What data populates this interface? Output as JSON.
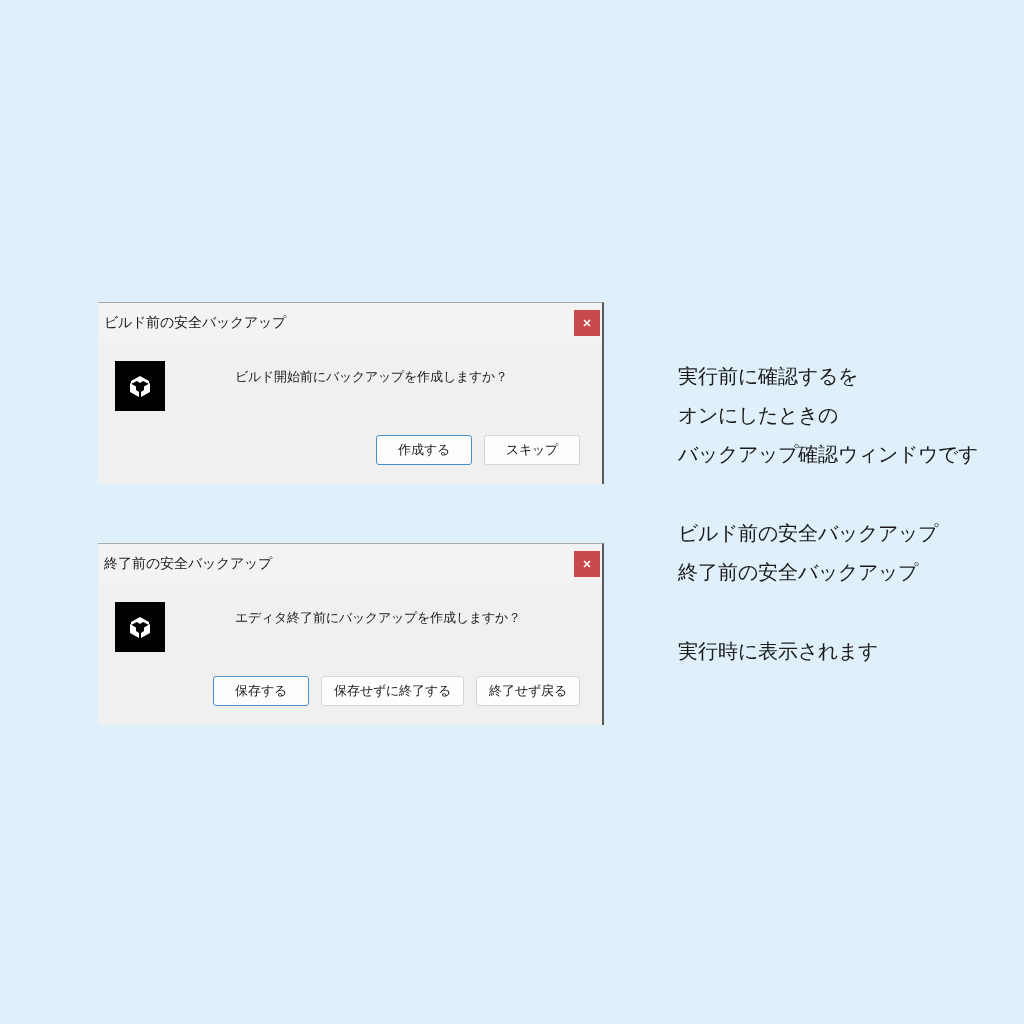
{
  "dialogs": [
    {
      "title": "ビルド前の安全バックアップ",
      "message": "ビルド開始前にバックアップを作成しますか？",
      "buttons": [
        {
          "label": "作成する",
          "default": true
        },
        {
          "label": "スキップ",
          "default": false
        }
      ]
    },
    {
      "title": "終了前の安全バックアップ",
      "message": "エディタ終了前にバックアップを作成しますか？",
      "buttons": [
        {
          "label": "保存する",
          "default": true
        },
        {
          "label": "保存せずに終了する",
          "default": false
        },
        {
          "label": "終了せず戻る",
          "default": false
        }
      ]
    }
  ],
  "notes": [
    {
      "lines": [
        "実行前に確認するを",
        "オンにしたときの",
        "バックアップ確認ウィンドウです"
      ]
    },
    {
      "lines": [
        "ビルド前の安全バックアップ",
        "終了前の安全バックアップ"
      ]
    },
    {
      "lines": [
        "実行時に表示されます"
      ]
    }
  ]
}
